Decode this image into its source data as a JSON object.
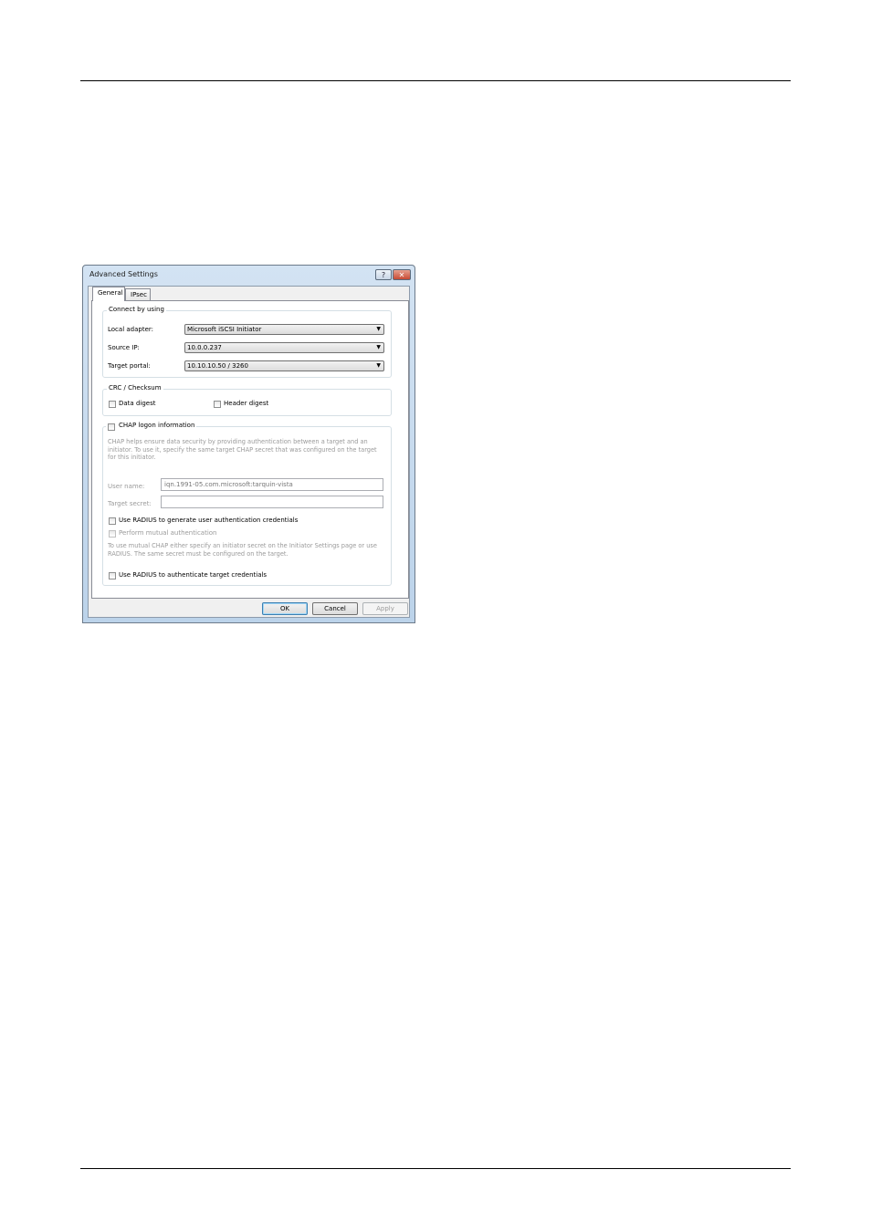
{
  "window": {
    "title": "Advanced Settings",
    "help_glyph": "?",
    "close_glyph": "✕"
  },
  "tabs": [
    {
      "label": "General",
      "active": true
    },
    {
      "label": "IPsec",
      "active": false
    }
  ],
  "connect": {
    "title": "Connect by using",
    "local_adapter_label": "Local adapter:",
    "local_adapter_value": "Microsoft iSCSI Initiator",
    "source_ip_label": "Source IP:",
    "source_ip_value": "10.0.0.237",
    "target_portal_label": "Target portal:",
    "target_portal_value": "10.10.10.50 / 3260"
  },
  "crc": {
    "title": "CRC / Checksum",
    "data_digest": "Data digest",
    "header_digest": "Header digest"
  },
  "chap": {
    "title": "CHAP logon information",
    "description": "CHAP helps ensure data security by providing authentication between a target and an initiator. To use it, specify the same target CHAP secret that was configured on the target for this initiator.",
    "user_name_label": "User name:",
    "user_name_value": "iqn.1991-05.com.microsoft:tarquin-vista",
    "target_secret_label": "Target secret:",
    "target_secret_value": "",
    "radius_generate": "Use RADIUS to generate user authentication credentials",
    "mutual_auth": "Perform mutual authentication",
    "mutual_note": "To use mutual CHAP either specify an initiator secret on the Initiator Settings page or use RADIUS.  The same secret must be configured on the target.",
    "radius_authenticate": "Use RADIUS to authenticate target credentials"
  },
  "buttons": {
    "ok": "OK",
    "cancel": "Cancel",
    "apply": "Apply"
  },
  "combo_arrow": "▼"
}
